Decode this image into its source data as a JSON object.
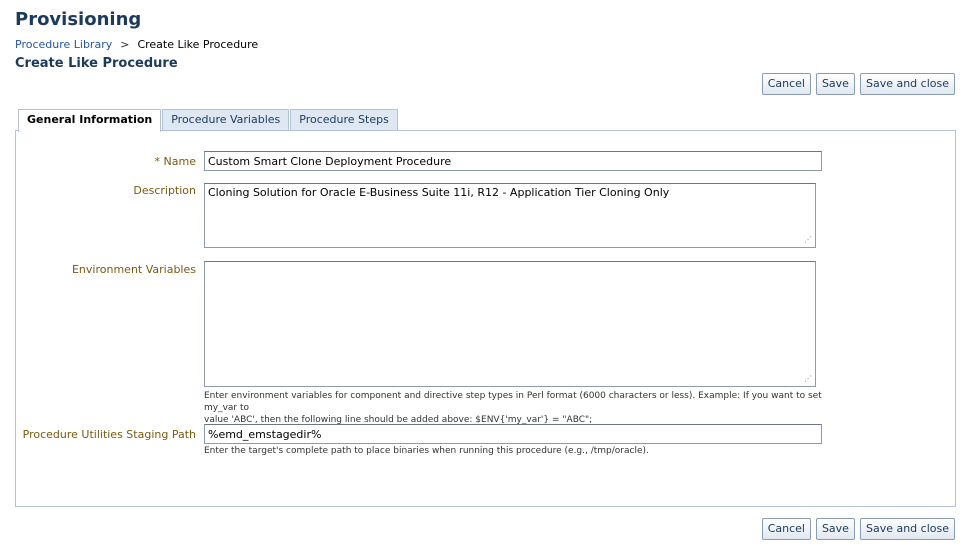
{
  "header": {
    "app_title": "Provisioning",
    "breadcrumb": {
      "link": "Procedure Library",
      "separator": ">",
      "current": "Create Like Procedure"
    },
    "page_title": "Create Like Procedure"
  },
  "actions": {
    "cancel": "Cancel",
    "save": "Save",
    "save_and_close": "Save and close"
  },
  "tabs": [
    {
      "label": "General Information",
      "active": true
    },
    {
      "label": "Procedure Variables",
      "active": false
    },
    {
      "label": "Procedure Steps",
      "active": false
    }
  ],
  "form": {
    "name": {
      "required_mark": "*",
      "label": "Name",
      "value": "Custom Smart Clone Deployment Procedure"
    },
    "description": {
      "label": "Description",
      "value": "Cloning Solution for Oracle E-Business Suite 11i, R12 - Application Tier Cloning Only"
    },
    "environment_variables": {
      "label": "Environment Variables",
      "value": "",
      "hint_line1": "Enter environment variables for component and directive step types in Perl format (6000 characters or less). Example: If you want to set my_var to",
      "hint_line2": "value 'ABC', then the following line should be added above: $ENV{'my_var'} = \"ABC\";"
    },
    "staging_path": {
      "label": "Procedure Utilities Staging Path",
      "value": "%emd_emstagedir%",
      "hint": "Enter the target's complete path to place binaries when running this procedure (e.g., /tmp/oracle)."
    }
  },
  "colors": {
    "title": "#1b3a5c",
    "link": "#2656a6",
    "label": "#7a5a12",
    "tab_inactive": "#dfe8f2",
    "border": "#b5c3d6"
  }
}
